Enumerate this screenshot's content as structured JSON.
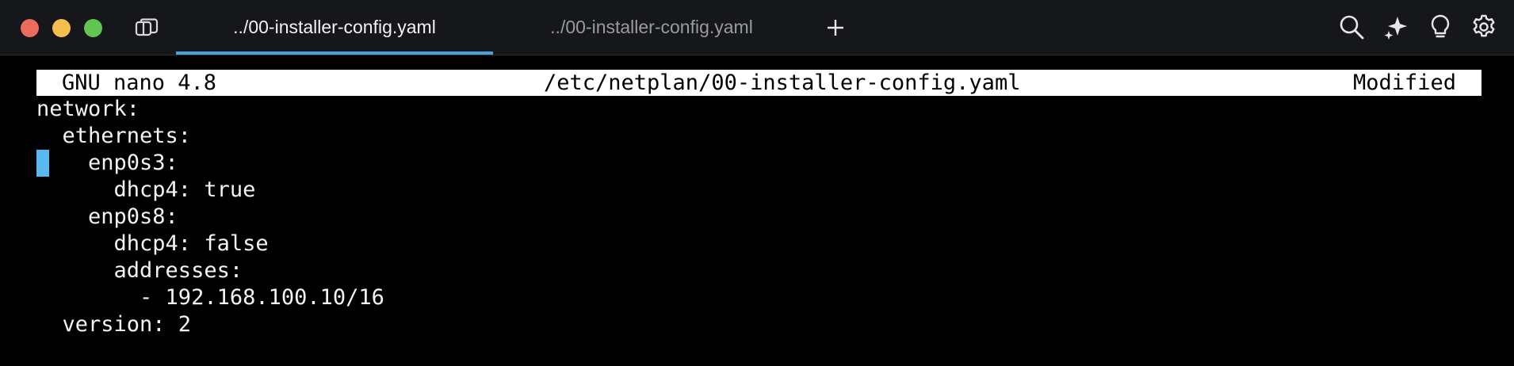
{
  "window": {
    "tabs": [
      {
        "label": "../00-installer-config.yaml",
        "active": true
      },
      {
        "label": "../00-installer-config.yaml",
        "active": false
      }
    ],
    "new_tab_symbol": "+",
    "toolbar_icons": [
      "search-icon",
      "sparkle-icon",
      "lightbulb-icon",
      "gear-icon"
    ],
    "colors": {
      "active_tab_indicator": "#4aa3df",
      "cursor": "#5ab8f0",
      "close": "#ed6a5e",
      "minimize": "#f5bf4f",
      "zoom": "#61c554"
    }
  },
  "nano": {
    "version": "GNU nano 4.8",
    "filename": "/etc/netplan/00-installer-config.yaml",
    "status": "Modified"
  },
  "editor": {
    "lines": [
      "network:",
      "  ethernets:",
      "    enp0s3:",
      "      dhcp4: true",
      "    enp0s8:",
      "      dhcp4: false",
      "      addresses:",
      "        - 192.168.100.10/16",
      "  version: 2"
    ]
  }
}
